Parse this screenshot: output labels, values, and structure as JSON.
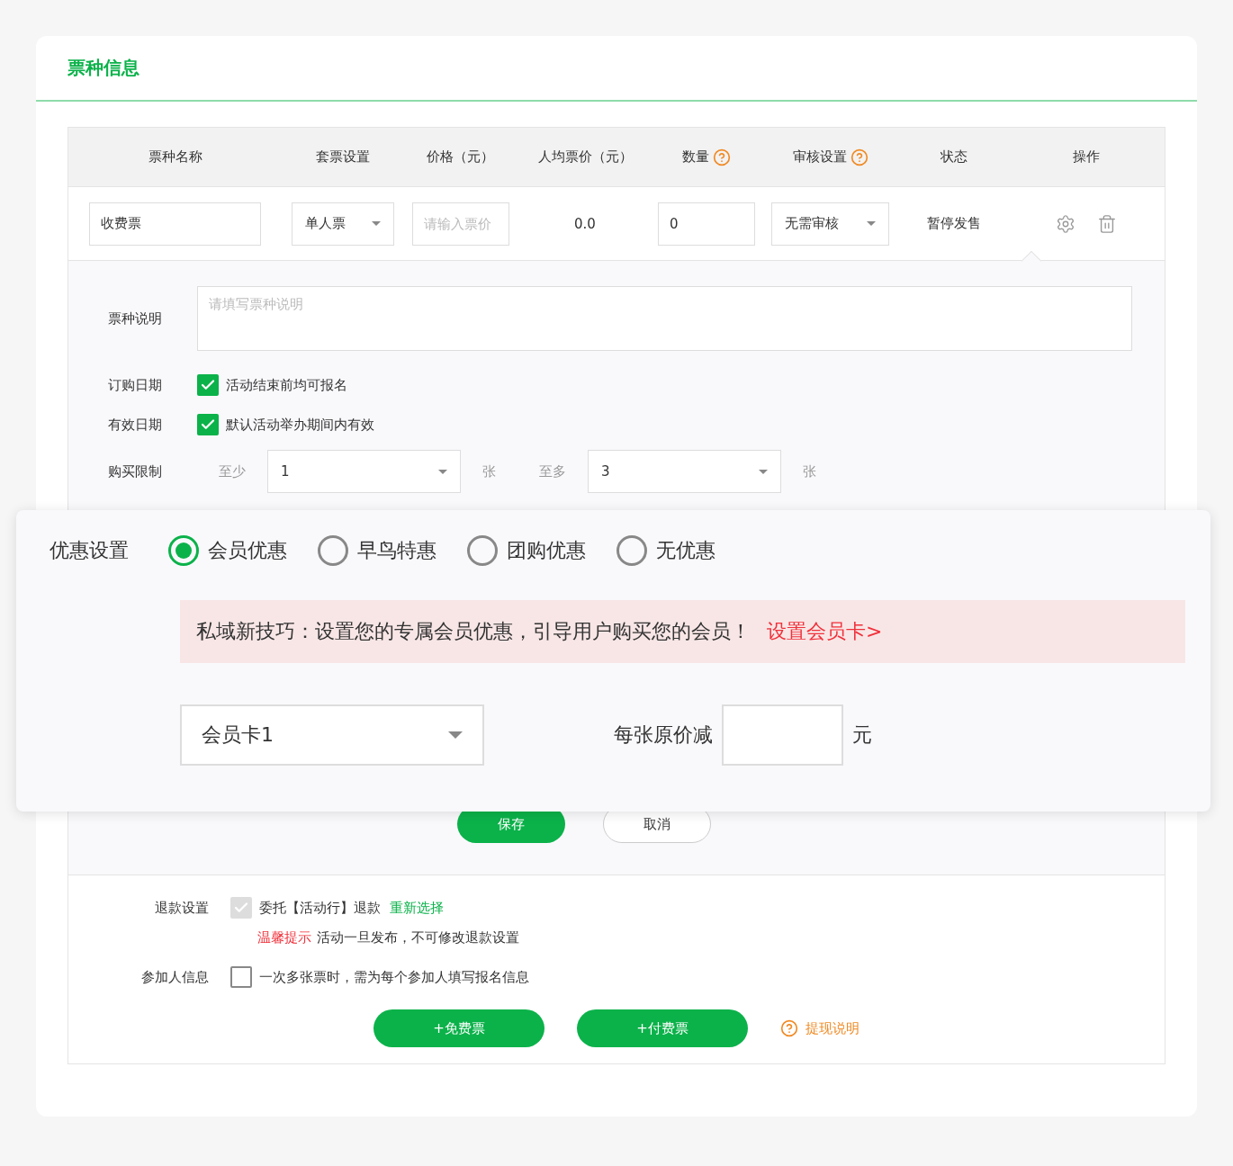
{
  "section_title": "票种信息",
  "table": {
    "columns": [
      {
        "label": "票种名称",
        "help": false
      },
      {
        "label": "套票设置",
        "help": false
      },
      {
        "label": "价格（元）",
        "help": false
      },
      {
        "label": "人均票价（元）",
        "help": false
      },
      {
        "label": "数量",
        "help": true
      },
      {
        "label": "审核设置",
        "help": true
      },
      {
        "label": "状态",
        "help": false
      },
      {
        "label": "操作",
        "help": false
      }
    ],
    "row": {
      "name": "收费票",
      "package": "单人票",
      "price_placeholder": "请输入票价",
      "average": "0.0",
      "quantity": "0",
      "review": "无需审核",
      "status": "暂停发售"
    }
  },
  "details": {
    "description": {
      "label": "票种说明",
      "placeholder": "请填写票种说明"
    },
    "order_date": {
      "label": "订购日期",
      "checked": true,
      "text": "活动结束前均可报名"
    },
    "valid_date": {
      "label": "有效日期",
      "checked": true,
      "text": "默认活动举办期间内有效"
    },
    "purchase_limit": {
      "label": "购买限制",
      "min_label": "至少",
      "min_value": "1",
      "min_unit": "张",
      "max_label": "至多",
      "max_value": "3",
      "max_unit": "张"
    },
    "buttons": {
      "save": "保存",
      "cancel": "取消"
    }
  },
  "discount": {
    "label": "优惠设置",
    "options": [
      {
        "label": "会员优惠",
        "selected": true
      },
      {
        "label": "早鸟特惠",
        "selected": false
      },
      {
        "label": "团购优惠",
        "selected": false
      },
      {
        "label": "无优惠",
        "selected": false
      }
    ],
    "tip": {
      "text": "私域新技巧：设置您的专属会员优惠，引导用户购买您的会员！",
      "link": "设置会员卡>"
    },
    "card": "会员卡1",
    "reduce_label": "每张原价减",
    "reduce_unit": "元"
  },
  "refund": {
    "label": "退款设置",
    "checked": true,
    "disabled": true,
    "text": "委托【活动行】退款",
    "link": "重新选择",
    "warning_label": "温馨提示",
    "warning_text": "活动一旦发布，不可修改退款设置"
  },
  "participant": {
    "label": "参加人信息",
    "checked": false,
    "text": "一次多张票时，需为每个参加人填写报名信息"
  },
  "footer": {
    "free": "+免费票",
    "paid": "+付费票",
    "help": "提现说明"
  }
}
